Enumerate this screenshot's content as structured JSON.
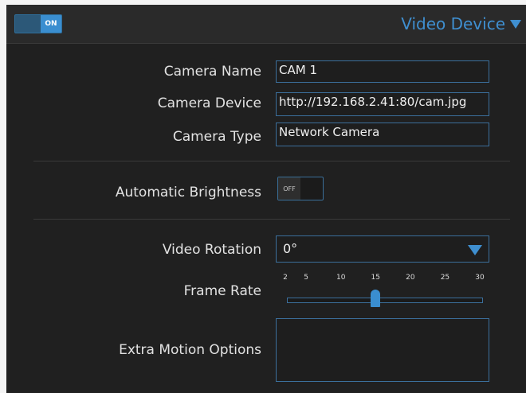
{
  "header": {
    "power_toggle": {
      "label": "ON",
      "state": "on"
    },
    "device_menu_label": "Video Device"
  },
  "form": {
    "camera_name": {
      "label": "Camera Name",
      "value": "CAM 1"
    },
    "camera_device": {
      "label": "Camera Device",
      "value": "http://192.168.2.41:80/cam.jpg"
    },
    "camera_type": {
      "label": "Camera Type",
      "value": "Network Camera"
    },
    "automatic_brightness": {
      "label": "Automatic Brightness",
      "toggle_label": "OFF",
      "state": "off"
    },
    "video_rotation": {
      "label": "Video Rotation",
      "value": "0°"
    },
    "frame_rate": {
      "label": "Frame Rate",
      "ticks": [
        "2",
        "5",
        "10",
        "15",
        "20",
        "25",
        "30"
      ],
      "min": 2,
      "max": 30,
      "value": 15
    },
    "extra_motion_options": {
      "label": "Extra Motion Options",
      "value": ""
    }
  },
  "colors": {
    "accent": "#3a8ed0",
    "panel": "#202020",
    "border": "#3b6f9c",
    "text": "#e2e2e2"
  }
}
